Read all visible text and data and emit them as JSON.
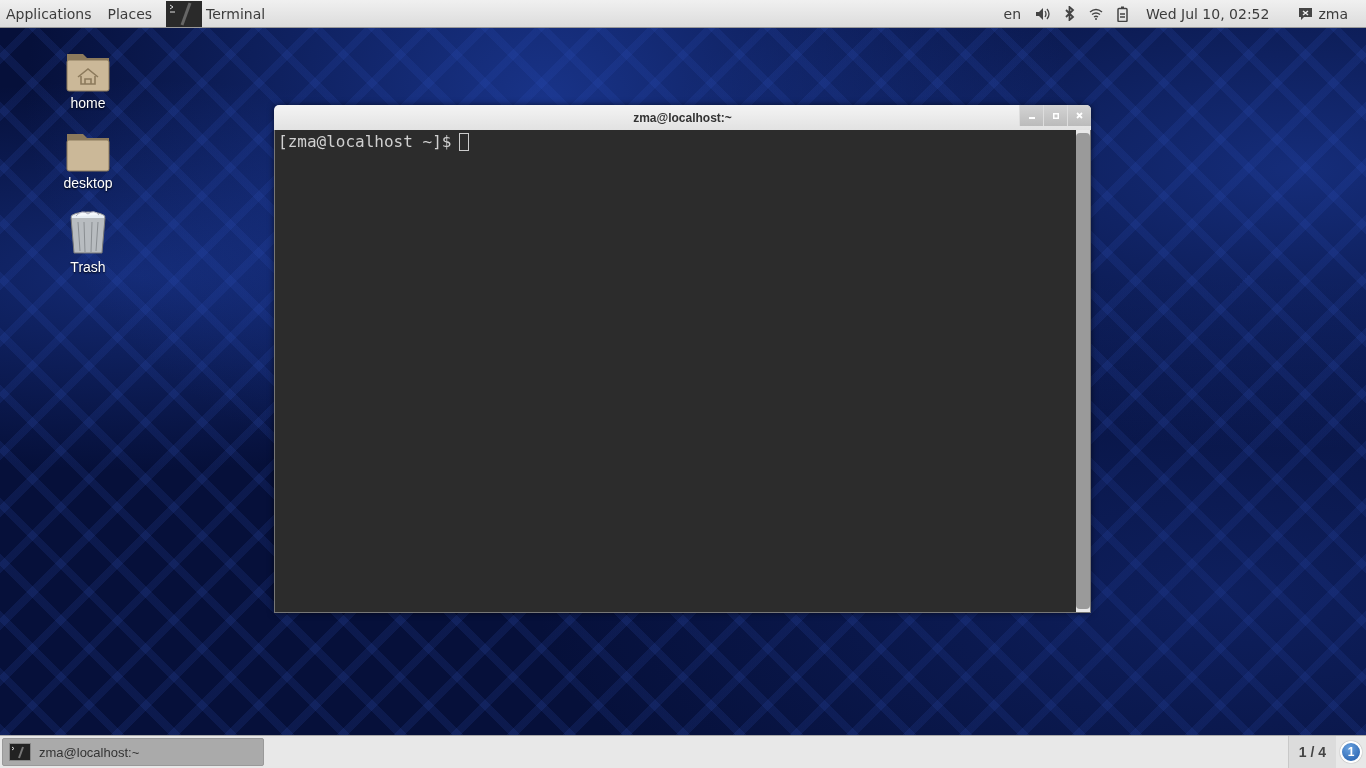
{
  "top_panel": {
    "menus": [
      "Applications",
      "Places"
    ],
    "active_app": "Terminal",
    "keyboard_layout": "en",
    "clock": "Wed Jul 10, 02:52",
    "user": "zma"
  },
  "desktop_icons": [
    {
      "label": "home",
      "kind": "home-folder"
    },
    {
      "label": "desktop",
      "kind": "folder"
    },
    {
      "label": "Trash",
      "kind": "trash"
    }
  ],
  "terminal_window": {
    "title": "zma@localhost:~",
    "prompt": "[zma@localhost ~]$"
  },
  "taskbar": {
    "tasks": [
      {
        "label": "zma@localhost:~",
        "selected": true
      }
    ],
    "workspace": "1 / 4",
    "notification_count": "1"
  }
}
